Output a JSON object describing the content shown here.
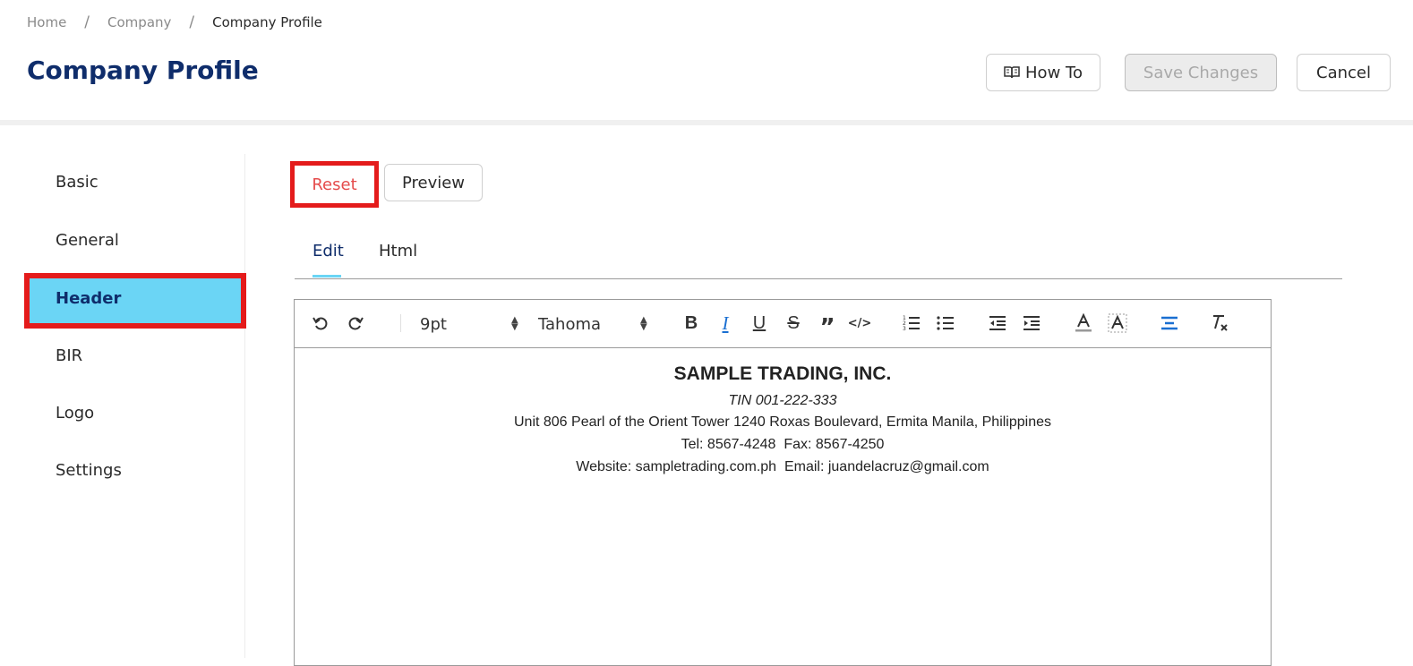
{
  "breadcrumb": {
    "home": "Home",
    "company": "Company",
    "current": "Company Profile",
    "separator": "/"
  },
  "page_title": "Company Profile",
  "header_buttons": {
    "how_to": "How To",
    "save": "Save Changes",
    "cancel": "Cancel"
  },
  "sidebar": {
    "items": [
      {
        "label": "Basic"
      },
      {
        "label": "General"
      },
      {
        "label": "Header"
      },
      {
        "label": "BIR"
      },
      {
        "label": "Logo"
      },
      {
        "label": "Settings"
      }
    ],
    "active": "Header"
  },
  "actions": {
    "reset": "Reset",
    "preview": "Preview"
  },
  "tabs": {
    "edit": "Edit",
    "html": "Html",
    "active": "Edit"
  },
  "toolbar": {
    "font_size": "9pt",
    "font_family": "Tahoma",
    "icons": [
      "undo-icon",
      "redo-icon",
      "bold-icon",
      "italic-icon",
      "underline-icon",
      "strikethrough-icon",
      "blockquote-icon",
      "code-icon",
      "ordered-list-icon",
      "bullet-list-icon",
      "outdent-icon",
      "indent-icon",
      "text-color-icon",
      "highlight-icon",
      "align-center-icon",
      "clear-format-icon"
    ]
  },
  "document": {
    "company_name": "SAMPLE TRADING, INC.",
    "tin": "TIN 001-222-333",
    "address": "Unit 806 Pearl of the Orient Tower 1240 Roxas Boulevard, Ermita Manila, Philippines",
    "contact": "Tel: 8567-4248  Fax: 8567-4250",
    "web": "Website: sampletrading.com.ph  Email: juandelacruz@gmail.com"
  },
  "colors": {
    "brand": "#0f2d6b",
    "active_bg": "#6bd5f5",
    "highlight_frame": "#e41b1b",
    "reset_text": "#e54b4b",
    "active_icon": "#1a6fd1"
  }
}
